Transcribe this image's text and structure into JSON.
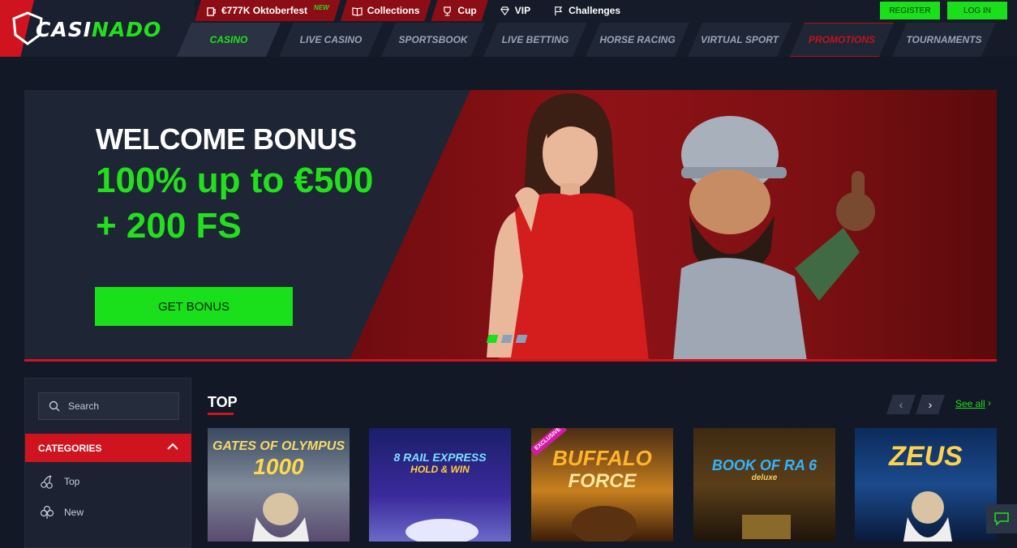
{
  "brand": {
    "logo_text_a": "CASI",
    "logo_text_b": "NADO"
  },
  "topbar": {
    "oktoberfest": "€777K Oktoberfest",
    "oktoberfest_badge": "NEW",
    "collections": "Collections",
    "cup": "Cup",
    "vip": "VIP",
    "challenges": "Challenges",
    "register": "REGISTER",
    "login": "LOG IN"
  },
  "nav": {
    "items": [
      {
        "label": "CASINO"
      },
      {
        "label": "LIVE CASINO"
      },
      {
        "label": "SPORTSBOOK"
      },
      {
        "label": "LIVE BETTING"
      },
      {
        "label": "HORSE RACING"
      },
      {
        "label": "VIRTUAL SPORT"
      },
      {
        "label": "PROMOTIONS"
      },
      {
        "label": "TOURNAMENTS"
      }
    ]
  },
  "hero": {
    "title": "WELCOME BONUS",
    "line1": "100% up to €500",
    "line2": "+ 200 FS",
    "button": "GET BONUS",
    "slides_total": 3,
    "slide_active": 1
  },
  "sidebar": {
    "search_placeholder": "Search",
    "categories_label": "CATEGORIES",
    "items": [
      {
        "label": "Top",
        "icon": "cherry-icon"
      },
      {
        "label": "New",
        "icon": "clover-icon"
      }
    ]
  },
  "games": {
    "section_title": "TOP",
    "see_all": "See all",
    "cards": [
      {
        "title": "GATES OF OLYMPUS",
        "subtitle": "1000"
      },
      {
        "title": "8 RAIL EXPRESS",
        "subtitle": "HOLD & WIN"
      },
      {
        "title": "BUFFALO",
        "subtitle": "FORCE",
        "badge": "EXCLUSIVE"
      },
      {
        "title": "BOOK OF RA 6",
        "subtitle": "deluxe"
      },
      {
        "title": "ZEUS",
        "subtitle": ""
      }
    ]
  },
  "colors": {
    "accent_green": "#19e01b",
    "accent_red": "#d0141f",
    "bg": "#121826"
  }
}
